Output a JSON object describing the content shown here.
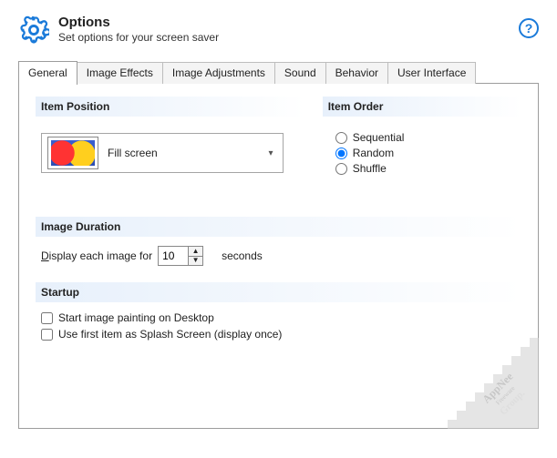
{
  "header": {
    "title": "Options",
    "subtitle": "Set options for your screen saver"
  },
  "tabs": {
    "t0": "General",
    "t1": "Image Effects",
    "t2": "Image Adjustments",
    "t3": "Sound",
    "t4": "Behavior",
    "t5": "User Interface"
  },
  "sections": {
    "item_position": "Item Position",
    "item_order": "Item Order",
    "image_duration": "Image Duration",
    "startup": "Startup"
  },
  "position": {
    "selected": "Fill screen"
  },
  "order": {
    "opt_sequential": "Sequential",
    "opt_random": "Random",
    "opt_shuffle": "Shuffle",
    "selected": "Random"
  },
  "duration": {
    "prefix_underline": "D",
    "prefix_rest": "isplay each image for",
    "value": "10",
    "suffix": "seconds"
  },
  "startup": {
    "opt1": "Start image painting on Desktop",
    "opt2": "Use first item as Splash Screen (display once)"
  },
  "watermark": {
    "line1": "AppNee",
    "line2": "Freeware",
    "line3": "Group."
  }
}
